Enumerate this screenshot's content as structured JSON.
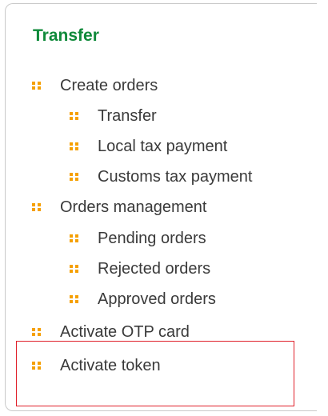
{
  "menu": {
    "title": "Transfer",
    "accent_color": "#0f8a3a",
    "bullet_color": "#f5a000",
    "highlight_color": "#e0202a",
    "items": [
      {
        "label": "Create orders",
        "level": 1
      },
      {
        "label": "Transfer",
        "level": 2
      },
      {
        "label": "Local tax payment",
        "level": 2
      },
      {
        "label": "Customs tax payment",
        "level": 2
      },
      {
        "label": "Orders management",
        "level": 1
      },
      {
        "label": "Pending orders",
        "level": 2
      },
      {
        "label": "Rejected orders",
        "level": 2
      },
      {
        "label": "Approved orders",
        "level": 2
      },
      {
        "label": "Activate OTP card",
        "level": 1
      },
      {
        "label": "Activate token",
        "level": 1
      }
    ]
  }
}
